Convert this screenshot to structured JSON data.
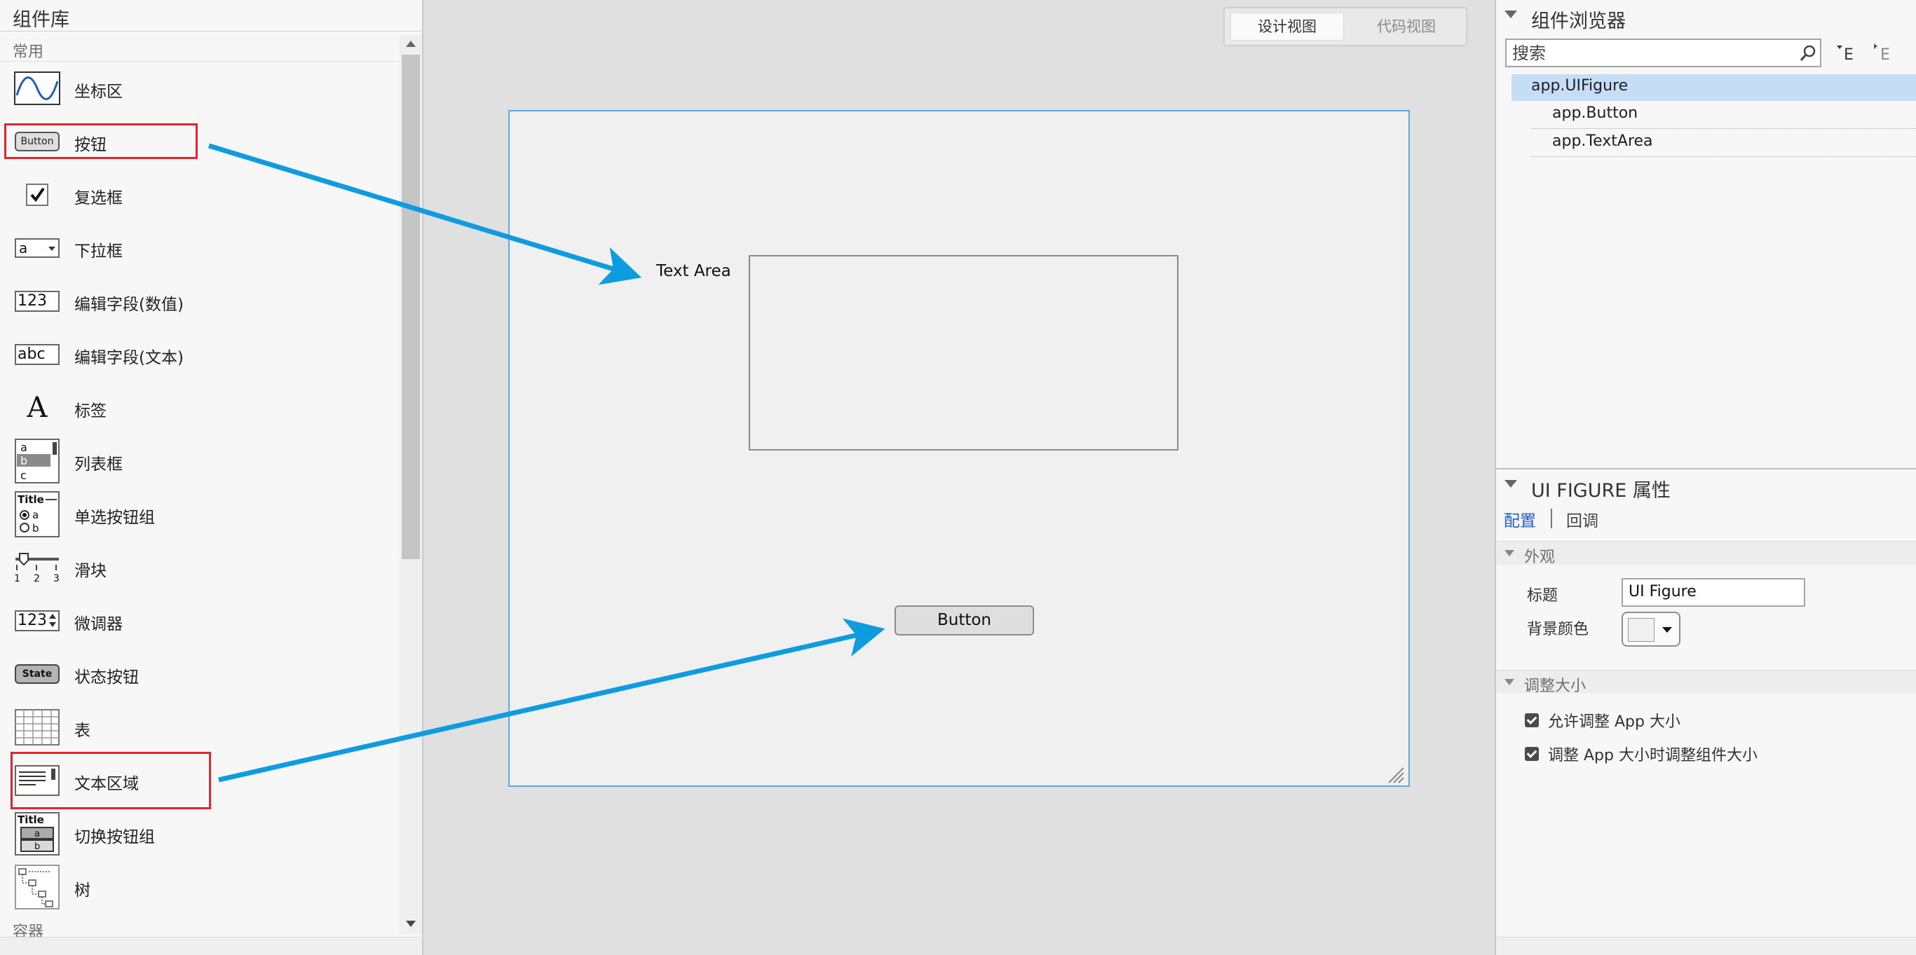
{
  "component_library": {
    "title": "组件库",
    "section_common": "常用",
    "section_container": "容器",
    "items": [
      {
        "label": "坐标区",
        "icon": "axes-icon"
      },
      {
        "label": "按钮",
        "icon": "button-icon",
        "icon_text": "Button"
      },
      {
        "label": "复选框",
        "icon": "checkbox-icon"
      },
      {
        "label": "下拉框",
        "icon": "dropdown-icon",
        "icon_text": "a"
      },
      {
        "label": "编辑字段(数值)",
        "icon": "numeric-field-icon",
        "icon_text": "123"
      },
      {
        "label": "编辑字段(文本)",
        "icon": "text-field-icon",
        "icon_text": "abc"
      },
      {
        "label": "标签",
        "icon": "label-icon",
        "icon_text": "A"
      },
      {
        "label": "列表框",
        "icon": "listbox-icon"
      },
      {
        "label": "单选按钮组",
        "icon": "radio-group-icon"
      },
      {
        "label": "滑块",
        "icon": "slider-icon"
      },
      {
        "label": "微调器",
        "icon": "spinner-icon",
        "icon_text": "123"
      },
      {
        "label": "状态按钮",
        "icon": "state-button-icon",
        "icon_text": "State"
      },
      {
        "label": "表",
        "icon": "table-icon"
      },
      {
        "label": "文本区域",
        "icon": "text-area-icon"
      },
      {
        "label": "切换按钮组",
        "icon": "toggle-group-icon"
      },
      {
        "label": "树",
        "icon": "tree-icon"
      }
    ],
    "highlighted_items": [
      "按钮",
      "文本区域"
    ],
    "highlight_color": "#e3262e"
  },
  "canvas": {
    "view_tabs": {
      "design": "设计视图",
      "code": "代码视图",
      "active": "设计视图"
    },
    "text_area_label": "Text Area",
    "button_text": "Button",
    "figure_border_color": "#5aa9e6",
    "arrow_color": "#0e9be0"
  },
  "component_browser": {
    "title": "组件浏览器",
    "search_placeholder": "搜索",
    "tree": [
      {
        "label": "app.UIFigure",
        "selected": true
      },
      {
        "label": "app.Button",
        "selected": false
      },
      {
        "label": "app.TextArea",
        "selected": false
      }
    ],
    "selected_color": "#c5def5"
  },
  "properties": {
    "title": "UI FIGURE 属性",
    "tabs": {
      "config": "配置",
      "callbacks": "回调",
      "active": "配置"
    },
    "section_appearance": "外观",
    "title_label": "标题",
    "title_value": "UI Figure",
    "bgcolor_label": "背景颜色",
    "section_resize": "调整大小",
    "checkboxes": [
      {
        "label": "允许调整 App 大小",
        "checked": true
      },
      {
        "label": "调整 App 大小时调整组件大小",
        "checked": true
      }
    ]
  }
}
